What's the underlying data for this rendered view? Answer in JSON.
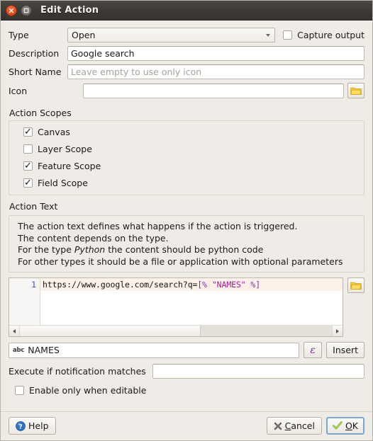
{
  "window": {
    "title": "Edit Action",
    "close_icon": "close-icon",
    "maximize_icon": "maximize-icon"
  },
  "form": {
    "type_label": "Type",
    "type_value": "Open",
    "capture_output_label": "Capture output",
    "capture_output_checked": false,
    "description_label": "Description",
    "description_value": "Google search",
    "short_name_label": "Short Name",
    "short_name_value": "",
    "short_name_placeholder": "Leave empty to use only icon",
    "icon_label": "Icon",
    "icon_value": "",
    "icon_browse_icon": "folder-icon"
  },
  "action_scopes": {
    "title": "Action Scopes",
    "items": [
      {
        "label": "Canvas",
        "checked": true,
        "tick": "✓"
      },
      {
        "label": "Layer Scope",
        "checked": false,
        "tick": ""
      },
      {
        "label": "Feature Scope",
        "checked": true,
        "tick": "✓"
      },
      {
        "label": "Field Scope",
        "checked": true,
        "tick": "✓"
      }
    ]
  },
  "action_text": {
    "title": "Action Text",
    "help_line_1": "The action text defines what happens if the action is triggered.",
    "help_line_2": "The content depends on the type.",
    "help_line_3_pre": "For the type ",
    "help_line_3_em": "Python",
    "help_line_3_post": " the content should be python code",
    "help_line_4": "For other types it should be a file or application with optional parameters",
    "editor": {
      "line_number": "1",
      "code_plain": "https://www.google.com/search?q=",
      "code_expr_open": "[% ",
      "code_string": "\"NAMES\"",
      "code_expr_close": " %]",
      "browse_icon": "folder-icon",
      "scroll_left_icon": "scroll-left-arrow-icon",
      "scroll_right_icon": "scroll-right-arrow-icon"
    },
    "field_selector": {
      "type_icon_label": "abc",
      "value": "NAMES",
      "expression_button_label": "ε",
      "insert_button_label": "Insert"
    },
    "notification_label": "Execute if notification matches",
    "notification_value": "",
    "enable_editable_label": "Enable only when editable",
    "enable_editable_checked": false
  },
  "footer": {
    "help_label": "Help",
    "help_icon": "help-icon",
    "cancel_label": "Cancel",
    "cancel_icon": "cancel-x-icon",
    "ok_label": "OK",
    "ok_icon": "check-icon"
  },
  "colors": {
    "dialog_bg": "#efece7",
    "titlebar": "#3c3936",
    "close_button": "#da4f22",
    "expression_purple": "#7a2f9e",
    "string_magenta": "#a8179c",
    "line_number_blue": "#3a52c8",
    "focus_blue": "#7ba7cf"
  }
}
